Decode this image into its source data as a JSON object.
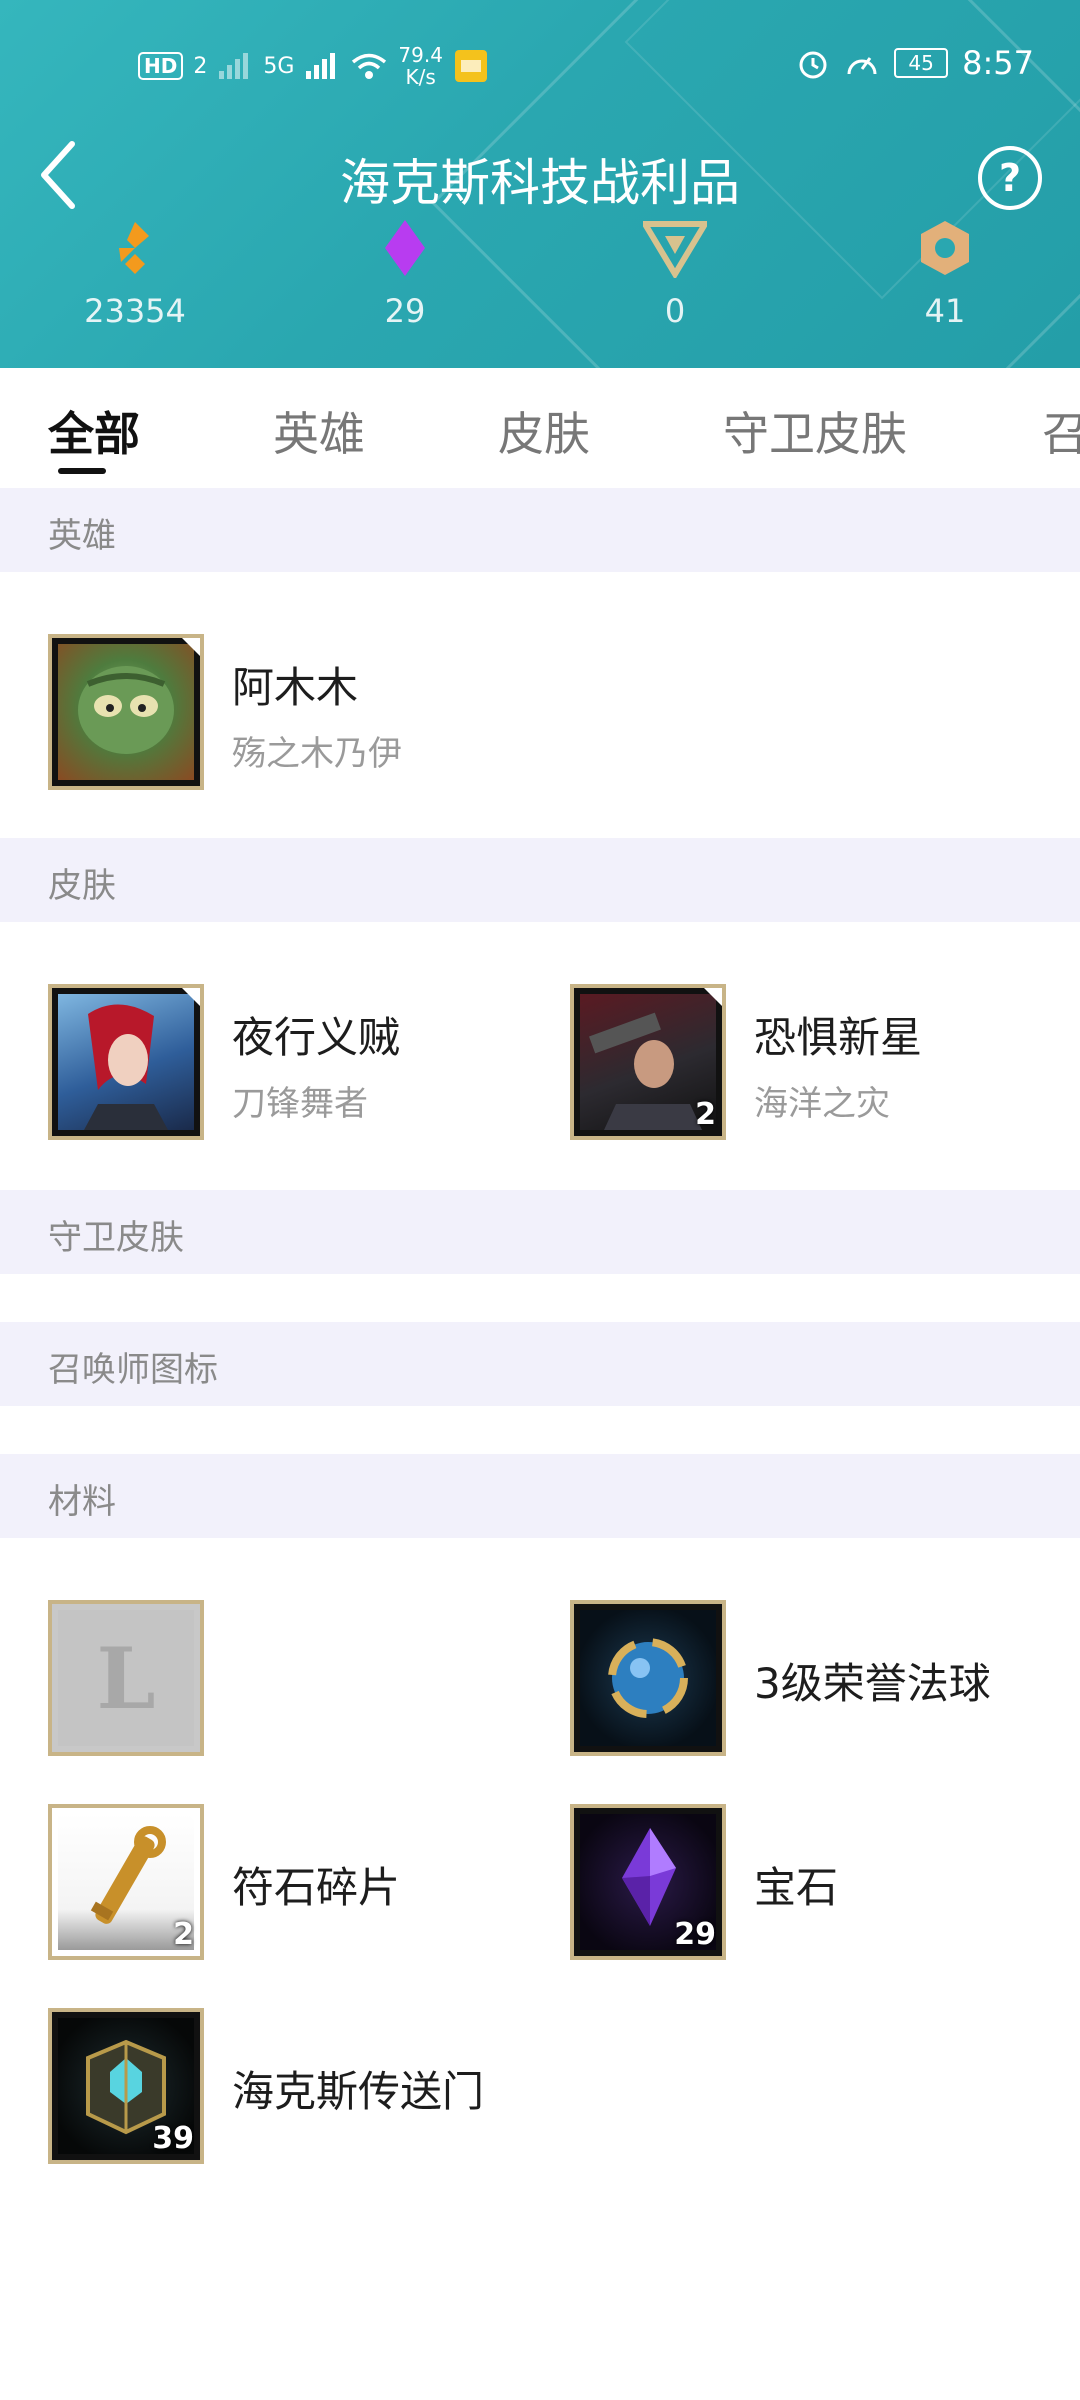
{
  "status": {
    "hd": "HD",
    "sim": "2",
    "net": "5G",
    "speed_value": "79.4",
    "speed_unit": "K/s",
    "battery": "45",
    "time": "8:57"
  },
  "header": {
    "title": "海克斯科技战利品",
    "currencies": [
      {
        "icon": "blue-essence-icon",
        "value": "23354",
        "color": "#f39a1d"
      },
      {
        "icon": "mythic-essence-icon",
        "value": "29",
        "color": "#b83cf0"
      },
      {
        "icon": "gemstone-essence-icon",
        "value": "0",
        "color": "#d8c28e"
      },
      {
        "icon": "orange-essence-icon",
        "value": "41",
        "color": "#e2b07a"
      }
    ]
  },
  "tabs": [
    "全部",
    "英雄",
    "皮肤",
    "守卫皮肤",
    "召"
  ],
  "sections": {
    "champions": "英雄",
    "skins": "皮肤",
    "ward_skins": "守卫皮肤",
    "summoner_icons": "召唤师图标",
    "materials": "材料"
  },
  "champions": [
    {
      "name": "阿木木",
      "subtitle": "殇之木乃伊"
    }
  ],
  "skins": [
    {
      "name": "夜行义贼",
      "subtitle": "刀锋舞者",
      "count": ""
    },
    {
      "name": "恐惧新星",
      "subtitle": "海洋之灾",
      "count": "2"
    }
  ],
  "materials": [
    {
      "name": "",
      "count": "",
      "placeholder_letter": "L"
    },
    {
      "name": "3级荣誉法球",
      "count": ""
    },
    {
      "name": "符石碎片",
      "count": "2"
    },
    {
      "name": "宝石",
      "count": "29"
    },
    {
      "name": "海克斯传送门",
      "count": "39"
    }
  ],
  "colors": {
    "header": "#2aa7b0",
    "section_bg": "#f2f1fb",
    "thumb_border": "#c8b487"
  }
}
